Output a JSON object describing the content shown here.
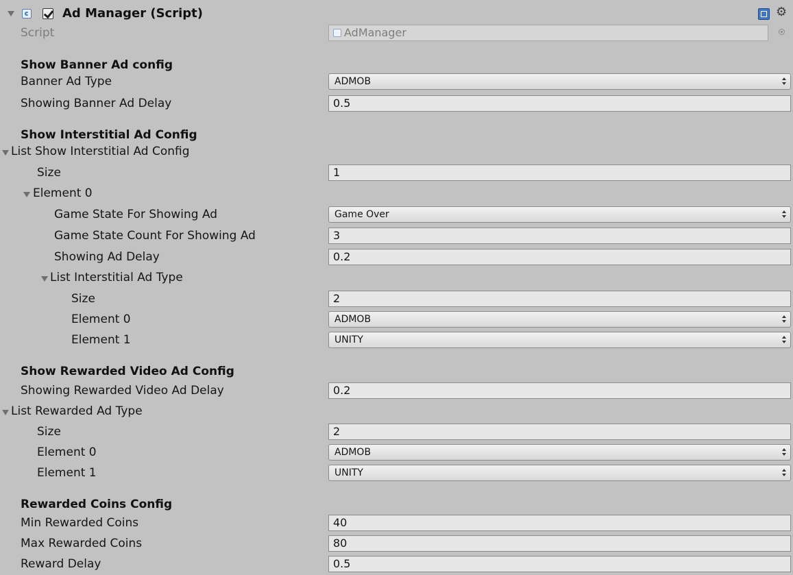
{
  "component": {
    "title": "Ad Manager (Script)",
    "enabled": true,
    "icons": [
      "foldout-expanded-icon",
      "script-icon",
      "enabled-checkbox",
      "help-icon",
      "gear-icon"
    ]
  },
  "script_field": {
    "label": "Script",
    "value": "AdManager"
  },
  "banner": {
    "section": "Show Banner Ad config",
    "type_label": "Banner Ad Type",
    "type_value": "ADMOB",
    "delay_label": "Showing Banner Ad Delay",
    "delay_value": "0.5"
  },
  "interstitial": {
    "section": "Show Interstitial Ad Config",
    "list_label": "List Show Interstitial Ad Config",
    "size_label": "Size",
    "size_value": "1",
    "element_label": "Element 0",
    "game_state_label": "Game State For Showing Ad",
    "game_state_value": "Game Over",
    "game_state_count_label": "Game State Count For Showing Ad",
    "game_state_count_value": "3",
    "showing_delay_label": "Showing Ad Delay",
    "showing_delay_value": "0.2",
    "ad_type_list_label": "List Interstitial Ad Type",
    "ad_type_size_label": "Size",
    "ad_type_size_value": "2",
    "ad_type_element0_label": "Element 0",
    "ad_type_element0_value": "ADMOB",
    "ad_type_element1_label": "Element 1",
    "ad_type_element1_value": "UNITY"
  },
  "rewarded": {
    "section": "Show Rewarded Video Ad Config",
    "delay_label": "Showing Rewarded Video Ad Delay",
    "delay_value": "0.2",
    "list_label": "List Rewarded Ad Type",
    "size_label": "Size",
    "size_value": "2",
    "element0_label": "Element 0",
    "element0_value": "ADMOB",
    "element1_label": "Element 1",
    "element1_value": "UNITY"
  },
  "coins": {
    "section": "Rewarded Coins Config",
    "min_label": "Min Rewarded Coins",
    "min_value": "40",
    "max_label": "Max Rewarded Coins",
    "max_value": "80",
    "delay_label": "Reward Delay",
    "delay_value": "0.5"
  }
}
